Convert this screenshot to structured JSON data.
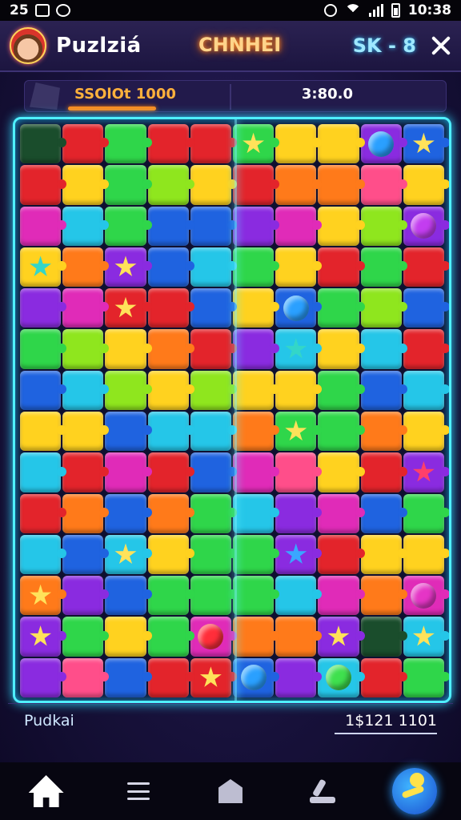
{
  "status_bar": {
    "left_text": "25",
    "time": "10:38"
  },
  "header": {
    "app_title": "Puzlziá",
    "mode_title": "CHNHEI",
    "right_label": "SK - 8"
  },
  "info_bar": {
    "score_label": "SSOlOt 1000",
    "timer": "3:80.0",
    "score_progress": 0.55
  },
  "board": {
    "columns": 10,
    "rows": 14,
    "tiles": [
      [
        "dark",
        "red",
        "green",
        "red",
        "red",
        "green:star",
        "yellow",
        "yellow",
        "purple:orb-blue",
        "blue:star"
      ],
      [
        "red",
        "yellow",
        "green",
        "lime",
        "yellow",
        "red",
        "orange",
        "orange",
        "pink",
        "yellow"
      ],
      [
        "magenta",
        "cyan",
        "green",
        "blue",
        "blue",
        "purple",
        "magenta",
        "yellow",
        "lime",
        "purple:orb-purple"
      ],
      [
        "yellow:star-teal",
        "orange",
        "purple:star",
        "blue",
        "cyan",
        "green",
        "yellow",
        "red",
        "green",
        "red"
      ],
      [
        "purple",
        "magenta",
        "red:star",
        "red",
        "blue",
        "yellow",
        "blue:orb-blue",
        "green",
        "lime",
        "blue"
      ],
      [
        "green",
        "lime",
        "yellow",
        "orange",
        "red",
        "purple",
        "cyan:star-teal",
        "yellow",
        "cyan",
        "red"
      ],
      [
        "blue",
        "cyan",
        "lime",
        "yellow",
        "lime",
        "yellow",
        "yellow",
        "green",
        "blue",
        "cyan"
      ],
      [
        "yellow",
        "yellow",
        "blue",
        "cyan",
        "cyan",
        "orange",
        "green:star",
        "green",
        "orange",
        "yellow"
      ],
      [
        "cyan",
        "red",
        "magenta",
        "red",
        "blue",
        "magenta",
        "pink",
        "yellow",
        "red",
        "purple:star-red"
      ],
      [
        "red",
        "orange",
        "blue",
        "orange",
        "green",
        "cyan",
        "purple",
        "magenta",
        "blue",
        "green"
      ],
      [
        "cyan",
        "blue",
        "cyan:star-purple",
        "yellow",
        "green",
        "green",
        "purple:star-blue",
        "red",
        "yellow",
        "yellow"
      ],
      [
        "orange:star",
        "purple",
        "blue",
        "green",
        "green",
        "green",
        "cyan",
        "magenta",
        "orange",
        "magenta:orb-magenta"
      ],
      [
        "purple:star",
        "green",
        "yellow",
        "green",
        "magenta:orb-red",
        "orange",
        "orange",
        "purple:star-purple",
        "dark",
        "cyan:star"
      ],
      [
        "purple",
        "pink",
        "blue",
        "red",
        "red:star",
        "blue:orb-blue",
        "purple",
        "cyan:orb-green",
        "red",
        "green"
      ]
    ]
  },
  "footer": {
    "left_label": "Pudkai",
    "right_value": "1$121 1101"
  },
  "nav": {
    "items": [
      "home-icon",
      "menu-icon",
      "house-icon",
      "brush-icon",
      "play-fab-icon"
    ]
  }
}
